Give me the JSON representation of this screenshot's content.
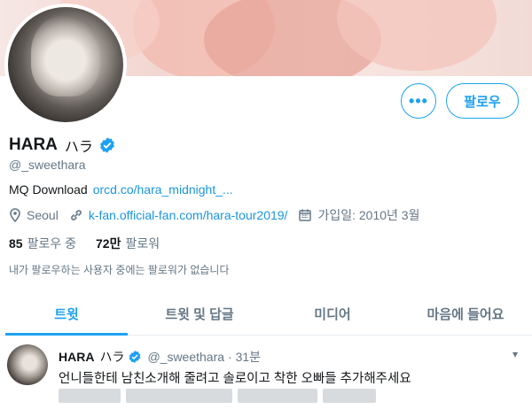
{
  "profile": {
    "name": "HARA",
    "name_jp": "ハラ",
    "handle": "@_sweethara",
    "bio_text": "MQ Download",
    "bio_link": "orcd.co/hara_midnight_...",
    "location": "Seoul",
    "website": "k-fan.official-fan.com/hara-tour2019/",
    "joined": "가입일: 2010년 3월",
    "following_count": "85",
    "following_label": "팔로우 중",
    "followers_count": "72만",
    "followers_label": "팔로워",
    "no_mutual": "내가 팔로우하는 사용자 중에는 팔로워가 없습니다"
  },
  "actions": {
    "more": "•••",
    "follow": "팔로우"
  },
  "tabs": [
    {
      "label": "트윗",
      "active": true
    },
    {
      "label": "트윗 및 답글",
      "active": false
    },
    {
      "label": "미디어",
      "active": false
    },
    {
      "label": "마음에 들어요",
      "active": false
    }
  ],
  "tweet": {
    "name": "HARA",
    "name_jp": "ハラ",
    "handle": "@_sweethara",
    "time": "· 31분",
    "text": "언니들한테 남친소개해 줄려고 솔로이고 착한 오빠들 추가해주세요"
  },
  "colors": {
    "accent": "#1da1f2",
    "link": "#1b95e0",
    "muted": "#657786"
  },
  "icons": [
    "location-icon",
    "link-icon",
    "calendar-icon",
    "verified-icon",
    "chevron-down-icon"
  ]
}
